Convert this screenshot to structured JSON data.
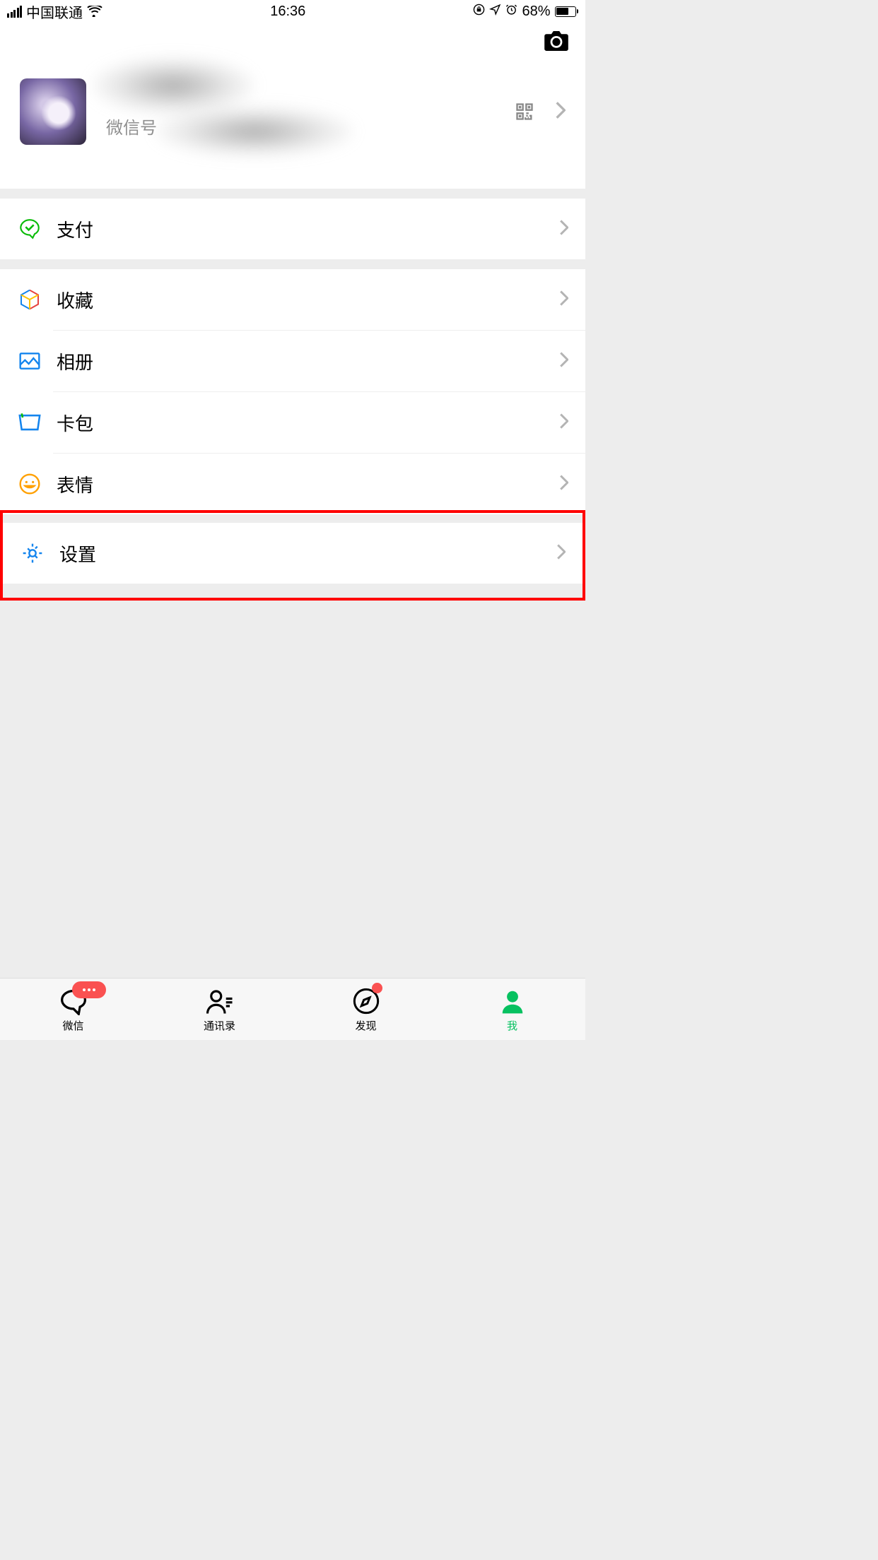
{
  "status_bar": {
    "carrier": "中国联通",
    "time": "16:36",
    "battery_percent": "68%"
  },
  "profile": {
    "wechat_id_label": "微信号"
  },
  "menu": {
    "pay": "支付",
    "favorites": "收藏",
    "album": "相册",
    "cards": "卡包",
    "stickers": "表情",
    "settings": "设置"
  },
  "tabs": {
    "chat": "微信",
    "contacts": "通讯录",
    "discover": "发现",
    "me": "我"
  }
}
